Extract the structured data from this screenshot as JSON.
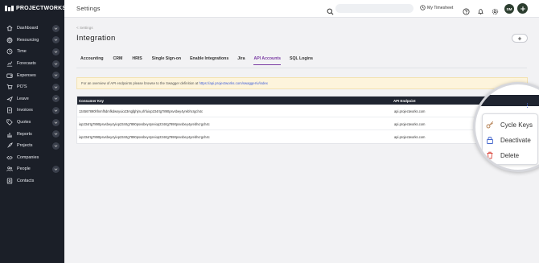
{
  "brand": {
    "name": "PROJECTWORKS"
  },
  "sidebar": {
    "items": [
      {
        "label": "Dashboard",
        "icon": "home-icon",
        "chevron": true
      },
      {
        "label": "Resourcing",
        "icon": "globe-icon",
        "chevron": true
      },
      {
        "label": "Time",
        "icon": "clock-icon",
        "chevron": true
      },
      {
        "label": "Forecasts",
        "icon": "chart-icon",
        "chevron": true
      },
      {
        "label": "Expenses",
        "icon": "wallet-icon",
        "chevron": true
      },
      {
        "label": "PO'S",
        "icon": "cart-icon",
        "chevron": true
      },
      {
        "label": "Leave",
        "icon": "plane-icon",
        "chevron": true
      },
      {
        "label": "Invoices",
        "icon": "invoice-icon",
        "chevron": true
      },
      {
        "label": "Quotes",
        "icon": "tag-icon",
        "chevron": true
      },
      {
        "label": "Reports",
        "icon": "report-icon",
        "chevron": true
      },
      {
        "label": "Projects",
        "icon": "rocket-icon",
        "chevron": true
      },
      {
        "label": "Companies",
        "icon": "handshake-icon",
        "chevron": false
      },
      {
        "label": "People",
        "icon": "people-icon",
        "chevron": true
      },
      {
        "label": "Contacts",
        "icon": "contacts-icon",
        "chevron": false
      }
    ]
  },
  "topbar": {
    "title": "Settings",
    "search_placeholder": "",
    "timesheet_label": "My Timesheet",
    "avatar_initials": "SM"
  },
  "page": {
    "breadcrumb": "< Settings",
    "title": "Integration"
  },
  "tabs": [
    {
      "label": "Accounting",
      "active": false
    },
    {
      "label": "CRM",
      "active": false
    },
    {
      "label": "HRIS",
      "active": false
    },
    {
      "label": "Single Sign-on",
      "active": false
    },
    {
      "label": "Enable Integrations",
      "active": false
    },
    {
      "label": "Jira",
      "active": false
    },
    {
      "label": "API Accounts",
      "active": true
    },
    {
      "label": "SQL Logins",
      "active": false
    }
  ],
  "banner": {
    "text": "For an overview of API endpoints please browse to the Swagger definition at",
    "link": "https://api.projectworks.com/swagger/v/index"
  },
  "table": {
    "headers": {
      "consumer_key": "Consumer Key",
      "api_endpoint": "API Endpoint"
    },
    "rows": [
      {
        "consumer_key": "134567890hfnmfhdmfkdwsyuio23rsgfghjm,xfrfuiop234rtg7890psvsbey4yrebhcrgch4c",
        "api_endpoint": "api.projectworks.com"
      },
      {
        "consumer_key": "iop234rtg7890psvsbey4yiop234rtg7890psvsbey4yreiop234rtg7890psvsbey4yrebhcrgch4c",
        "api_endpoint": "api.projectworks.com"
      },
      {
        "consumer_key": "iop234rtg7890psvsbey4yiop234rtg7890psvsbey4yreiop234rtg7890psvsbey4yrebhcrgch4c",
        "api_endpoint": "api.projectworks.com"
      }
    ]
  },
  "context_menu": {
    "items": [
      {
        "label": "Cycle Keys",
        "icon": "key-icon"
      },
      {
        "label": "Deactivate",
        "icon": "lock-icon"
      },
      {
        "label": "Delete",
        "icon": "trash-icon"
      }
    ]
  },
  "colors": {
    "sidebar_bg": "#1b1f28",
    "accent": "#7a3ba3",
    "table_header_bg": "#1f2430",
    "banner_bg": "#fdf4dc",
    "link": "#3c5bd9",
    "delete_red": "#d9453b",
    "deactivate_blue": "#4466cc"
  }
}
